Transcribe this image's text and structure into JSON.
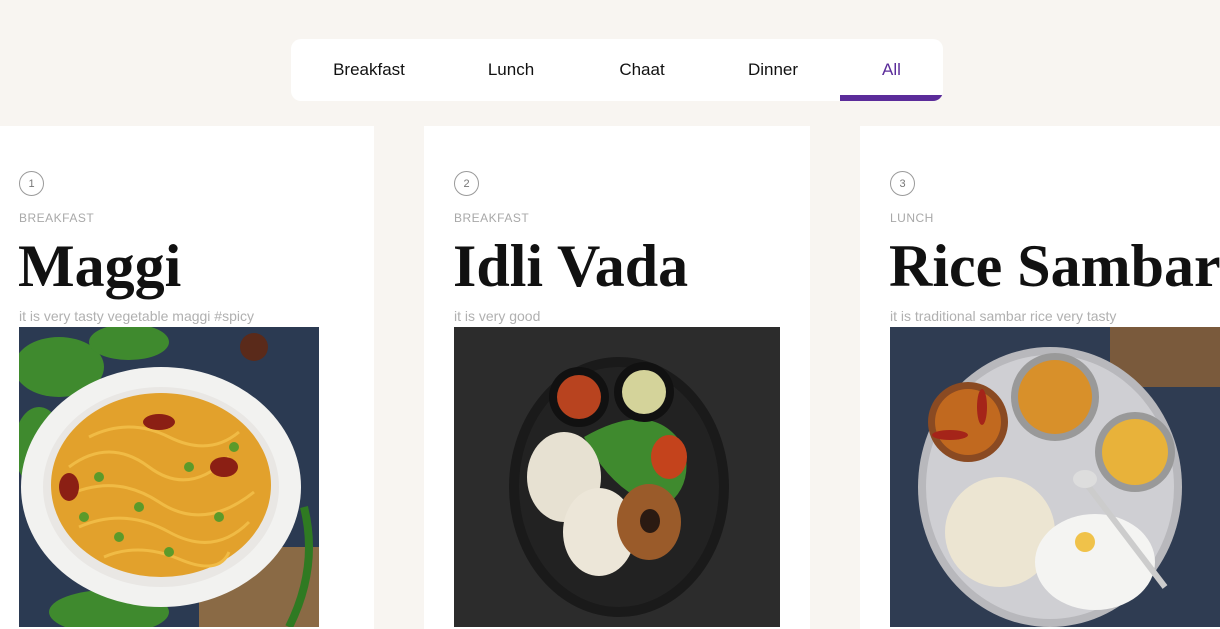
{
  "tabs": [
    {
      "label": "Breakfast",
      "active": false
    },
    {
      "label": "Lunch",
      "active": false
    },
    {
      "label": "Chaat",
      "active": false
    },
    {
      "label": "Dinner",
      "active": false
    },
    {
      "label": "All",
      "active": true
    }
  ],
  "colors": {
    "accent": "#5b2c9a",
    "page_bg": "#f8f5f1"
  },
  "cards": [
    {
      "number": "1",
      "category": "BREAKFAST",
      "title": "Maggi",
      "description": "it is very tasty vegetable maggi #spicy",
      "image": "maggi-noodles-photo"
    },
    {
      "number": "2",
      "category": "BREAKFAST",
      "title": "Idli Vada",
      "description": "it is very good",
      "image": "idli-vada-photo"
    },
    {
      "number": "3",
      "category": "LUNCH",
      "title": "Rice Sambar",
      "description": "it is traditional sambar rice very tasty",
      "image": "rice-sambar-thali-photo"
    }
  ]
}
